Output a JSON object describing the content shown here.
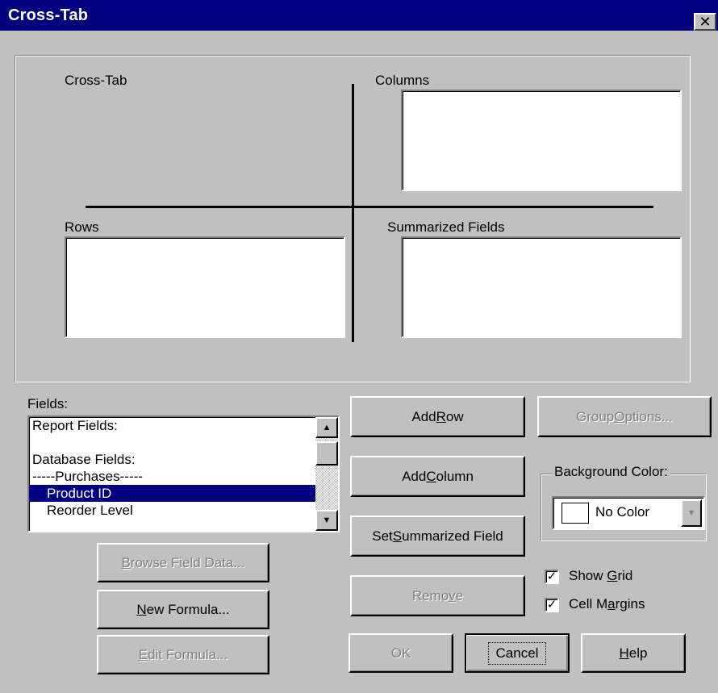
{
  "window": {
    "title": "Cross-Tab",
    "close_glyph": "✕"
  },
  "layout": {
    "crosstab_label": "Cross-Tab",
    "columns_label": "Columns",
    "rows_label": "Rows",
    "summarized_label": "Summarized Fields"
  },
  "fields": {
    "label": "Fields:",
    "items": [
      {
        "text": "Report Fields:",
        "selected": false
      },
      {
        "text": "",
        "selected": false
      },
      {
        "text": "Database Fields:",
        "selected": false
      },
      {
        "text": "-----Purchases-----",
        "selected": false
      },
      {
        "text": "Product ID",
        "selected": true
      },
      {
        "text": "Reorder Level",
        "selected": false
      }
    ]
  },
  "buttons": {
    "add_row": {
      "pre": "Add ",
      "key": "R",
      "post": "ow"
    },
    "add_column": {
      "pre": "Add ",
      "key": "C",
      "post": "olumn"
    },
    "set_summarized": {
      "pre": "Set ",
      "key": "S",
      "post": "ummarized Field"
    },
    "remove": {
      "pre": "Remo",
      "key": "v",
      "post": "e"
    },
    "group_options": {
      "pre": "Group ",
      "key": "O",
      "post": "ptions..."
    },
    "browse": {
      "pre": "",
      "key": "B",
      "post": "rowse Field Data..."
    },
    "new_formula": {
      "pre": "",
      "key": "N",
      "post": "ew Formula..."
    },
    "edit_formula": {
      "pre": "",
      "key": "E",
      "post": "dit Formula..."
    },
    "ok": "OK",
    "cancel": "Cancel",
    "help": {
      "pre": "",
      "key": "H",
      "post": "elp"
    }
  },
  "background_color": {
    "label": "Background Color:",
    "value": "No Color",
    "swatch": "#ffffff"
  },
  "options": {
    "show_grid": {
      "pre": "Show ",
      "key": "G",
      "post": "rid",
      "checked": true
    },
    "cell_margins": {
      "pre": "Cell M",
      "key": "a",
      "post": "rgins",
      "checked": true
    }
  },
  "colors": {
    "titlebar": "#000080",
    "face": "#c0c0c0",
    "selection": "#000080"
  }
}
